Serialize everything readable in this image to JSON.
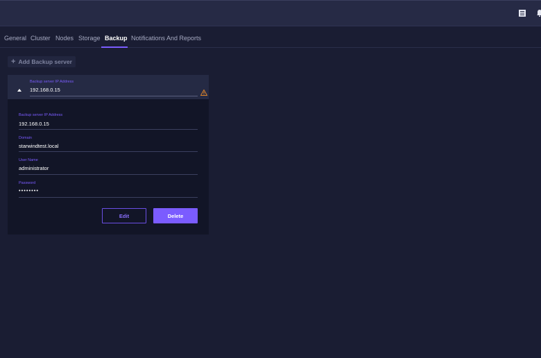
{
  "topbar": {
    "icons": [
      "list-icon",
      "bell-icon"
    ]
  },
  "tabs": [
    {
      "label": "General"
    },
    {
      "label": "Cluster"
    },
    {
      "label": "Nodes"
    },
    {
      "label": "Storage"
    },
    {
      "label": "Backup",
      "active": true
    },
    {
      "label": "Notifications And Reports"
    }
  ],
  "add_button": {
    "label": "Add Backup server"
  },
  "server_card": {
    "header": {
      "label": "Backup server IP Address",
      "value": "192.168.0.15",
      "status_icon": "warning-icon",
      "expanded": true
    },
    "fields": [
      {
        "label": "Backup server IP Address",
        "value": "192.168.0.15"
      },
      {
        "label": "Domain",
        "value": "starwindtest.local"
      },
      {
        "label": "User Name",
        "value": "administrator"
      },
      {
        "label": "Password",
        "value": "••••••••"
      }
    ],
    "edit_label": "Edit",
    "delete_label": "Delete"
  },
  "colors": {
    "accent": "#7b5cff",
    "background": "#1a1d33",
    "topbar": "#262a45",
    "warning": "#d9822b"
  }
}
